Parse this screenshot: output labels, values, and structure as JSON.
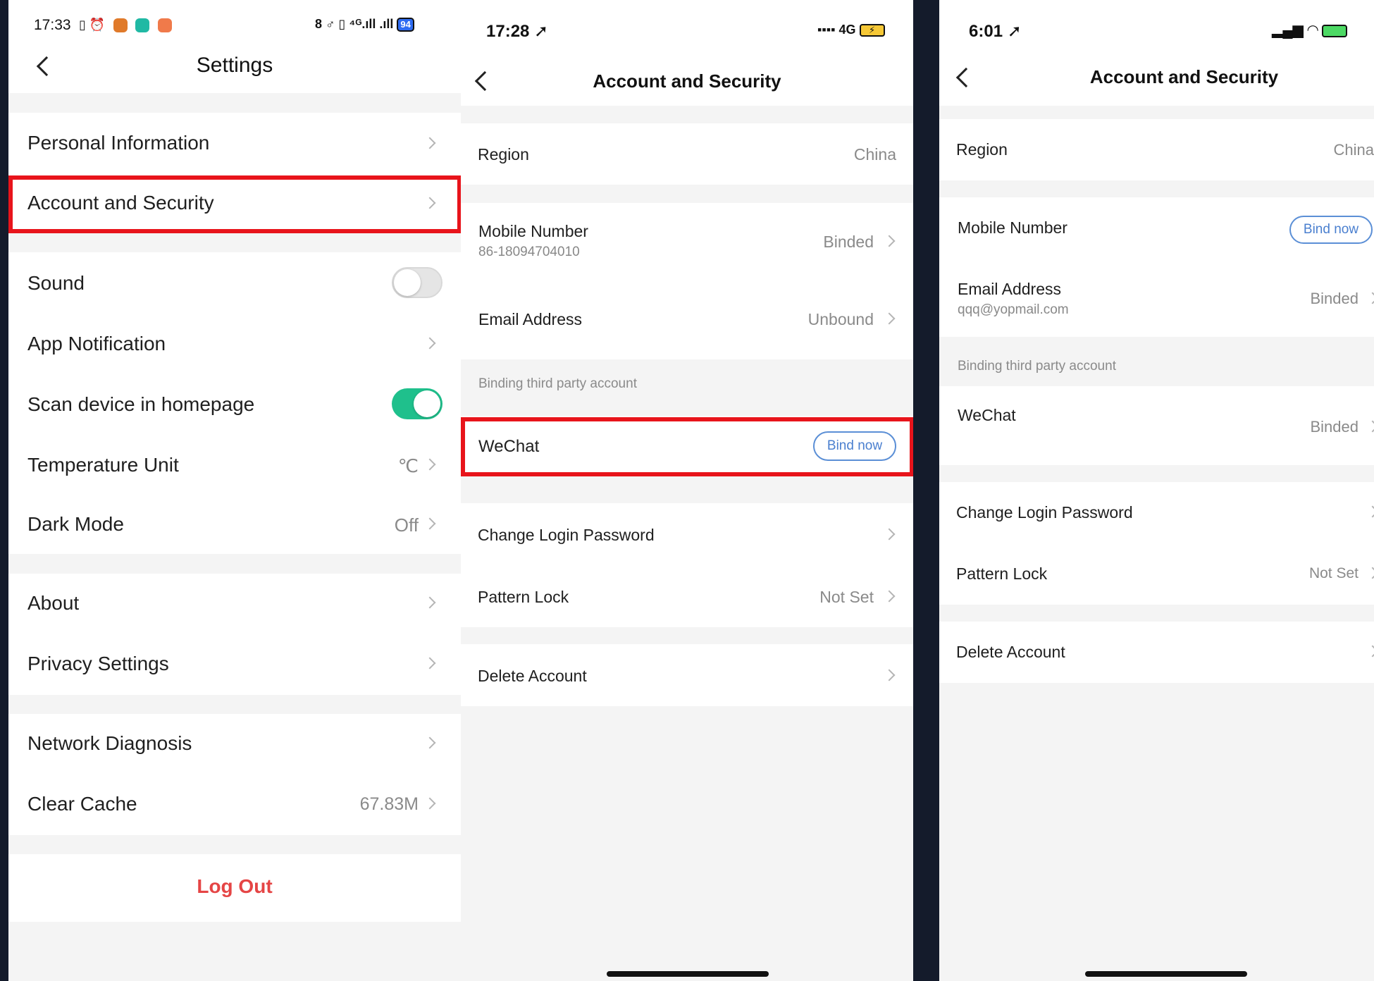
{
  "screen1": {
    "status": {
      "time": "17:33",
      "icons": "8 ♂ ▯ ⁴ᴳ.ıll .ıll",
      "battery": "94"
    },
    "title": "Settings",
    "rows": {
      "personal": {
        "label": "Personal Information"
      },
      "account": {
        "label": "Account and Security"
      },
      "sound": {
        "label": "Sound",
        "toggle": "off"
      },
      "notification": {
        "label": "App Notification"
      },
      "scan": {
        "label": "Scan device in homepage",
        "toggle": "on"
      },
      "temperature": {
        "label": "Temperature Unit",
        "value": "℃"
      },
      "dark": {
        "label": "Dark Mode",
        "value": "Off"
      },
      "about": {
        "label": "About"
      },
      "privacy": {
        "label": "Privacy Settings"
      },
      "network": {
        "label": "Network Diagnosis"
      },
      "cache": {
        "label": "Clear Cache",
        "value": "67.83M"
      }
    },
    "logout": "Log Out"
  },
  "screen2": {
    "status": {
      "time": "17:28 ➚",
      "network": "4G"
    },
    "title": "Account and Security",
    "region": {
      "label": "Region",
      "value": "China"
    },
    "mobile": {
      "label": "Mobile Number",
      "sub": "86-18094704010",
      "value": "Binded"
    },
    "email": {
      "label": "Email Address",
      "value": "Unbound"
    },
    "section": "Binding third party account",
    "wechat": {
      "label": "WeChat",
      "button": "Bind now"
    },
    "password": {
      "label": "Change Login Password"
    },
    "pattern": {
      "label": "Pattern Lock",
      "value": "Not Set"
    },
    "delete": {
      "label": "Delete Account"
    }
  },
  "screen3": {
    "status": {
      "time": "6:01 ➚"
    },
    "title": "Account and Security",
    "region": {
      "label": "Region",
      "value": "China"
    },
    "mobile": {
      "label": "Mobile Number",
      "button": "Bind now"
    },
    "email": {
      "label": "Email Address",
      "sub": "qqq@yopmail.com",
      "value": "Binded"
    },
    "section": "Binding third party account",
    "wechat": {
      "label": "WeChat",
      "value": "Binded"
    },
    "password": {
      "label": "Change Login Password"
    },
    "pattern": {
      "label": "Pattern Lock",
      "value": "Not Set"
    },
    "delete": {
      "label": "Delete Account"
    }
  },
  "colors": {
    "highlight": "#e8141b",
    "toggle_on": "#1fc08c",
    "logout": "#e54545",
    "bind": "#4a7fcf"
  }
}
